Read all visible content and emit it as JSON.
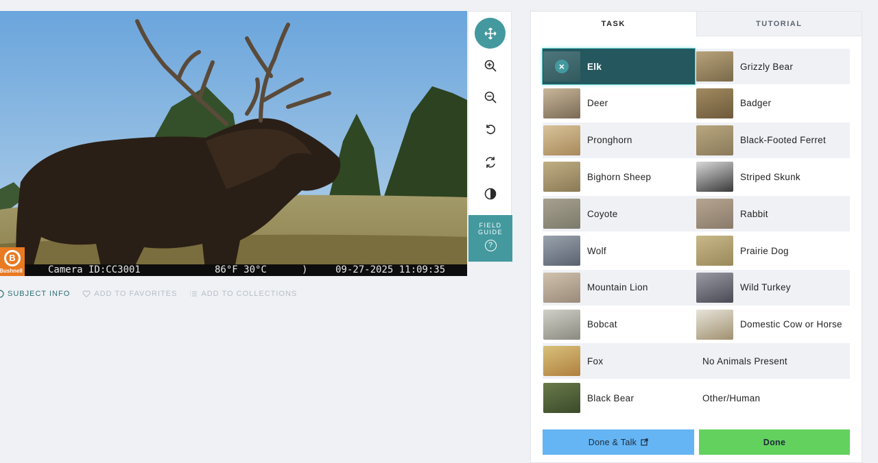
{
  "camera": {
    "logo": "Bushnell",
    "camera_id": "Camera ID:CC3001",
    "temperature": "86°F 30°C",
    "moon": ")",
    "datetime": "09-27-2025 11:09:35"
  },
  "toolbar": {
    "tools": [
      {
        "name": "move-icon",
        "active": true
      },
      {
        "name": "zoom-in-icon",
        "active": false
      },
      {
        "name": "zoom-out-icon",
        "active": false
      },
      {
        "name": "rotate-icon",
        "active": false
      },
      {
        "name": "reset-icon",
        "active": false
      },
      {
        "name": "invert-icon",
        "active": false
      }
    ],
    "field_guide_line1": "FIELD",
    "field_guide_line2": "GUIDE",
    "field_guide_icon": "?"
  },
  "meta": {
    "subject_info": "SUBJECT INFO",
    "add_to_favorites": "ADD TO FAVORITES",
    "add_to_collections": "ADD TO COLLECTIONS"
  },
  "tabs": {
    "task": "TASK",
    "tutorial": "TUTORIAL"
  },
  "choices": [
    {
      "label": "Elk",
      "selected": true
    },
    {
      "label": "Grizzly Bear"
    },
    {
      "label": "Deer"
    },
    {
      "label": "Badger"
    },
    {
      "label": "Pronghorn"
    },
    {
      "label": "Black-Footed Ferret"
    },
    {
      "label": "Bighorn Sheep"
    },
    {
      "label": "Striped Skunk"
    },
    {
      "label": "Coyote"
    },
    {
      "label": "Rabbit"
    },
    {
      "label": "Wolf"
    },
    {
      "label": "Prairie Dog"
    },
    {
      "label": "Mountain Lion"
    },
    {
      "label": "Wild Turkey"
    },
    {
      "label": "Bobcat"
    },
    {
      "label": "Domestic Cow or Horse"
    },
    {
      "label": "Fox"
    },
    {
      "label": "No Animals Present"
    },
    {
      "label": "Black Bear"
    },
    {
      "label": "Other/Human"
    }
  ],
  "actions": {
    "done_talk": "Done & Talk",
    "done": "Done"
  },
  "colors": {
    "teal": "#43999e",
    "selected_bg": "#24575e",
    "talk_blue": "#65b5f4",
    "done_green": "#63d15e"
  }
}
